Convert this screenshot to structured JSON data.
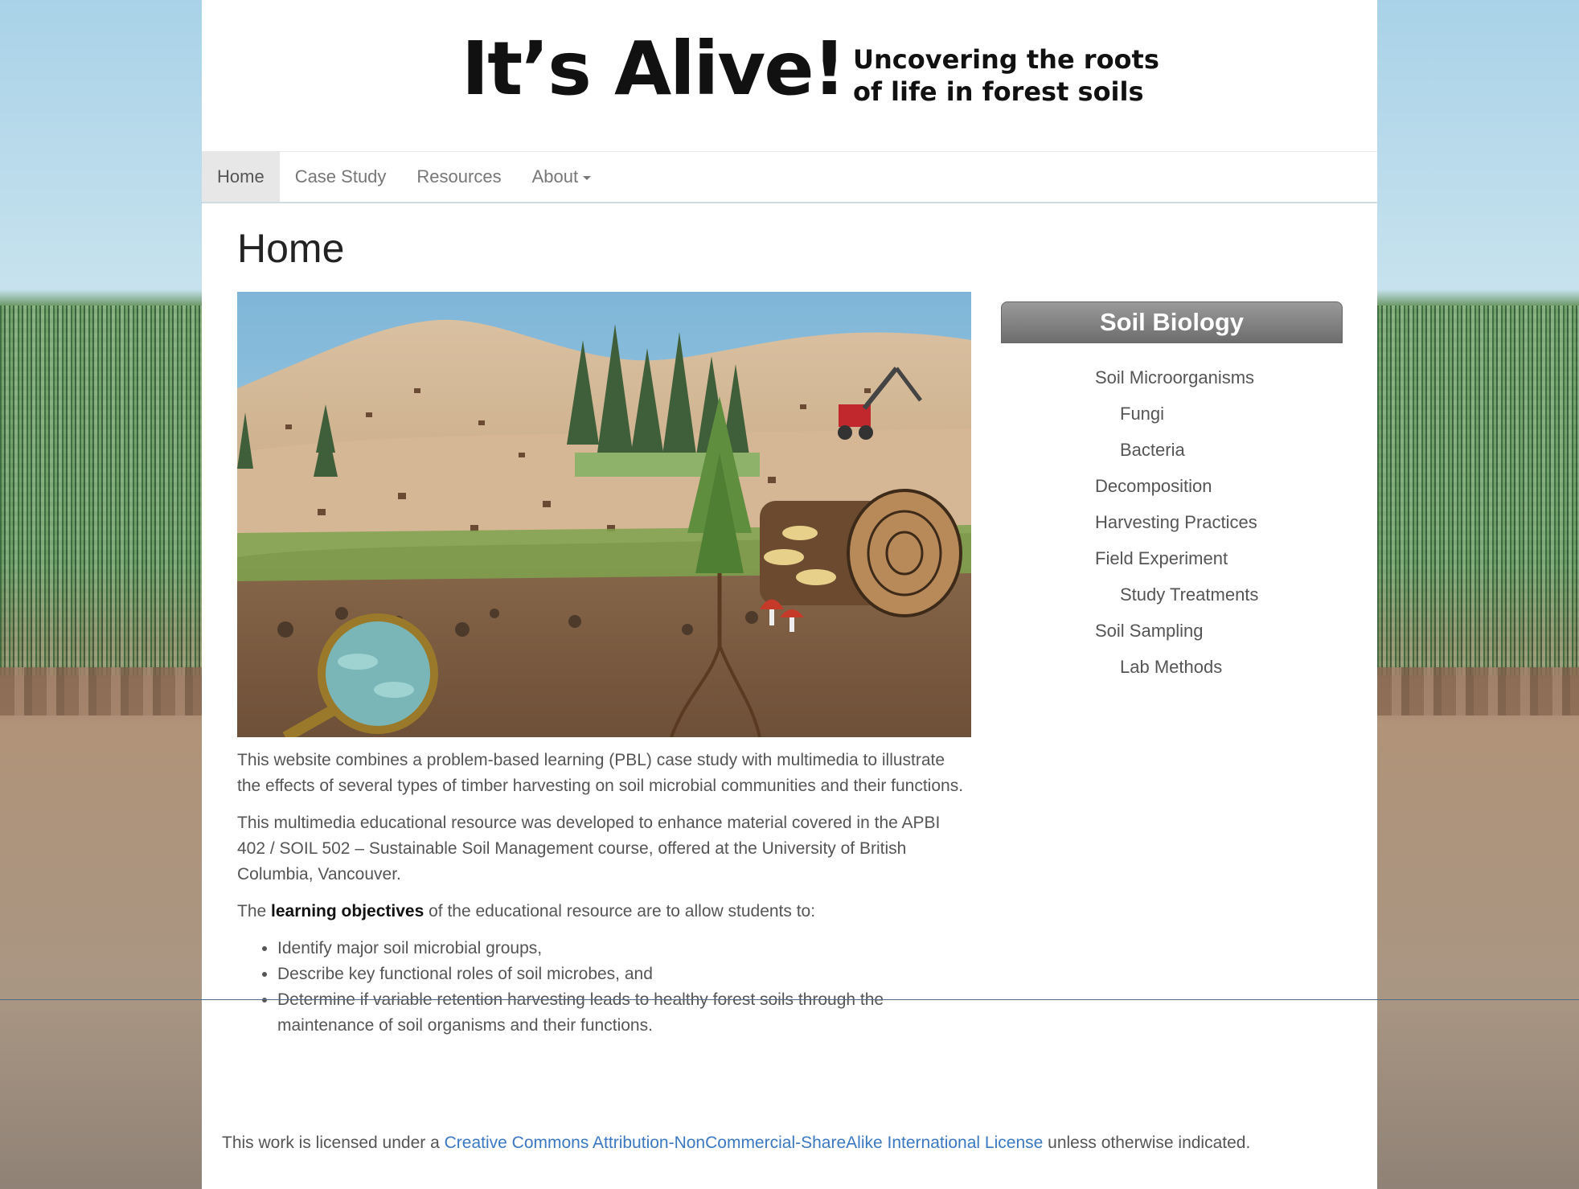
{
  "banner": {
    "title": "It’s Alive!",
    "subtitle_line1": "Uncovering the roots",
    "subtitle_line2": "of life in forest soils"
  },
  "nav": {
    "items": [
      {
        "label": "Home",
        "active": true
      },
      {
        "label": "Case Study",
        "active": false
      },
      {
        "label": "Resources",
        "active": false
      },
      {
        "label": "About",
        "active": false,
        "dropdown": true
      }
    ]
  },
  "page": {
    "title": "Home"
  },
  "content": {
    "para1": "This website combines a problem-based learning (PBL) case study with multimedia to illustrate the effects of several types of timber harvesting on soil microbial communities and their functions.",
    "para2": "This multimedia educational resource was developed to enhance material covered in the APBI 402 / SOIL 502 – Sustainable Soil Management course, offered at the University of British Columbia, Vancouver.",
    "objectives_prefix": "The",
    "objectives_bold": "learning objectives",
    "objectives_suffix": "of the educational resource are to allow students to:",
    "objectives": [
      "Identify major soil microbial groups,",
      "Describe key functional roles of soil microbes, and",
      "Determine if variable retention harvesting leads to healthy forest soils through the maintenance of soil organisms and their functions."
    ]
  },
  "sidebar": {
    "header": "Soil Biology",
    "items": [
      {
        "label": "Soil Microorganisms",
        "level": 1
      },
      {
        "label": "Fungi",
        "level": 2
      },
      {
        "label": "Bacteria",
        "level": 2
      },
      {
        "label": "Decomposition",
        "level": 1
      },
      {
        "label": "Harvesting Practices",
        "level": 1
      },
      {
        "label": "Field Experiment",
        "level": 1
      },
      {
        "label": "Study Treatments",
        "level": 2
      },
      {
        "label": "Soil Sampling",
        "level": 1
      },
      {
        "label": "Lab Methods",
        "level": 2
      }
    ]
  },
  "footer": {
    "prefix": "This work is licensed under a",
    "link": "Creative Commons Attribution-NonCommercial-ShareAlike International License",
    "suffix": "unless otherwise indicated."
  },
  "colors": {
    "link": "#3b78c2",
    "sidebar_header": "#7a7a7a",
    "nav_active_bg": "#e7e7e7"
  }
}
